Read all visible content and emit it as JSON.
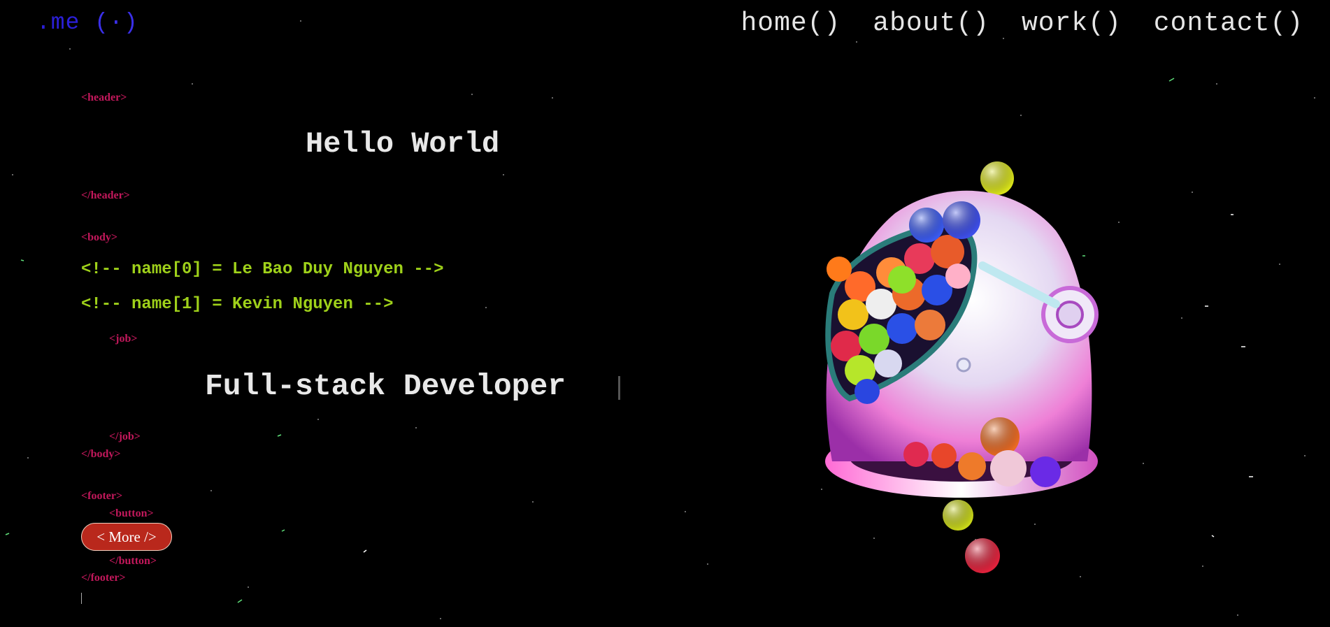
{
  "nav": {
    "logo_text": ".me",
    "logo_paren": "(·)",
    "links": [
      "home()",
      "about()",
      "work()",
      "contact()"
    ]
  },
  "code": {
    "header_open": "<header>",
    "title": "Hello World",
    "header_close": "</header>",
    "body_open": "<body>",
    "name0": "<!-- name[0] = Le Bao Duy Nguyen -->",
    "name1": "<!-- name[1] = Kevin Nguyen -->",
    "job_open": "<job>",
    "job_title": "Full-stack Developer",
    "job_close": "</job>",
    "body_close": "</body>",
    "footer_open": "<footer>",
    "button_open": "<button>",
    "button_label": "< More />",
    "button_close": "</button>",
    "footer_close": "</footer>"
  },
  "colors": {
    "background": "#000000",
    "tag": "#c2185b",
    "comment": "#9fd11a",
    "logo": "#2b1fd8",
    "button": "#b9281c"
  }
}
